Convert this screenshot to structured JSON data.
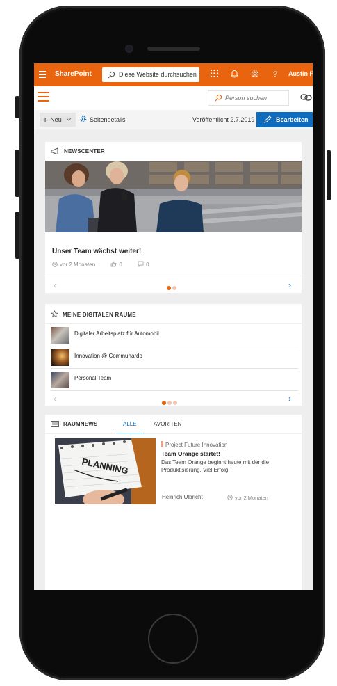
{
  "topbar": {
    "brand": "SharePoint",
    "search_placeholder": "Diese Website durchsuchen",
    "user": "Austin Powers",
    "accent": "#e8640f"
  },
  "suitebar": {
    "person_search_placeholder": "Person suchen"
  },
  "cmdbar": {
    "new_label": "Neu",
    "details_label": "Seitendetails",
    "published": "Veröffentlicht 2.7.2019",
    "edit_label": "Bearbeiten"
  },
  "newscenter": {
    "title": "NEWSCENTER",
    "article_title": "Unser Team wächst weiter!",
    "time": "vor 2 Monaten",
    "likes": "0",
    "comments": "0"
  },
  "rooms": {
    "title": "MEINE DIGITALEN RÄUME",
    "items": [
      {
        "label": "Digitaler Arbeitsplatz für Automobil"
      },
      {
        "label": "Innovation @ Communardo"
      },
      {
        "label": "Personal Team"
      }
    ]
  },
  "roomnews": {
    "title": "RAUMNEWS",
    "tabs": [
      "ALLE",
      "FAVORITEN"
    ],
    "image_text": "PLANNING",
    "category": "Project Future Innovation",
    "article_title": "Team Orange startet!",
    "text": "Das Team Orange beginnt heute mit der die Produktisierung. Viel Erfolg!",
    "author": "Heinrich Ulbricht",
    "time": "vor 2 Monaten"
  }
}
